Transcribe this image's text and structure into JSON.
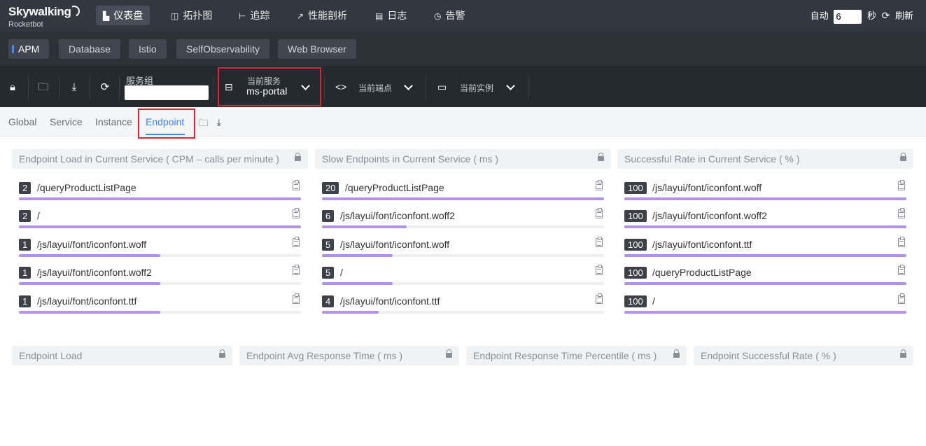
{
  "brand": {
    "name": "Skywalking",
    "subtitle": "Rocketbot"
  },
  "topnav": {
    "items": [
      {
        "label": "仪表盘",
        "icon": "dashboard-icon",
        "active": true
      },
      {
        "label": "拓扑图",
        "icon": "topology-icon",
        "active": false
      },
      {
        "label": "追踪",
        "icon": "trace-icon",
        "active": false
      },
      {
        "label": "性能剖析",
        "icon": "profile-icon",
        "active": false
      },
      {
        "label": "日志",
        "icon": "log-icon",
        "active": false
      },
      {
        "label": "告警",
        "icon": "alarm-icon",
        "active": false
      }
    ],
    "auto_label": "自动",
    "auto_value": "6",
    "seconds_label": "秒",
    "refresh_label": "刷新"
  },
  "layers": {
    "items": [
      {
        "label": "APM",
        "active": true
      },
      {
        "label": "Database",
        "active": false
      },
      {
        "label": "Istio",
        "active": false
      },
      {
        "label": "SelfObservability",
        "active": false
      },
      {
        "label": "Web Browser",
        "active": false
      }
    ]
  },
  "toolbar": {
    "service_group_label": "服务组",
    "service_group_value": "",
    "current_service_label": "当前服务",
    "current_service_value": "ms-portal",
    "current_endpoint_label": "当前端点",
    "current_instance_label": "当前实例"
  },
  "dashboard_tabs": {
    "items": [
      {
        "label": "Global",
        "active": false
      },
      {
        "label": "Service",
        "active": false
      },
      {
        "label": "Instance",
        "active": false
      },
      {
        "label": "Endpoint",
        "active": true
      }
    ]
  },
  "panels": [
    {
      "title": "Endpoint Load in Current Service ( CPM – calls per minute )",
      "rows": [
        {
          "value": "2",
          "name": "/queryProductListPage",
          "fill": 1.0
        },
        {
          "value": "2",
          "name": "/",
          "fill": 1.0
        },
        {
          "value": "1",
          "name": "/js/layui/font/iconfont.woff",
          "fill": 0.5
        },
        {
          "value": "1",
          "name": "/js/layui/font/iconfont.woff2",
          "fill": 0.5
        },
        {
          "value": "1",
          "name": "/js/layui/font/iconfont.ttf",
          "fill": 0.5
        }
      ]
    },
    {
      "title": "Slow Endpoints in Current Service ( ms )",
      "rows": [
        {
          "value": "20",
          "name": "/queryProductListPage",
          "fill": 1.0
        },
        {
          "value": "6",
          "name": "/js/layui/font/iconfont.woff2",
          "fill": 0.3
        },
        {
          "value": "5",
          "name": "/js/layui/font/iconfont.woff",
          "fill": 0.25
        },
        {
          "value": "5",
          "name": "/",
          "fill": 0.25
        },
        {
          "value": "4",
          "name": "/js/layui/font/iconfont.ttf",
          "fill": 0.2
        }
      ]
    },
    {
      "title": "Successful Rate in Current Service ( % )",
      "rows": [
        {
          "value": "100",
          "name": "/js/layui/font/iconfont.woff",
          "fill": 1.0
        },
        {
          "value": "100",
          "name": "/js/layui/font/iconfont.woff2",
          "fill": 1.0
        },
        {
          "value": "100",
          "name": "/js/layui/font/iconfont.ttf",
          "fill": 1.0
        },
        {
          "value": "100",
          "name": "/queryProductListPage",
          "fill": 1.0
        },
        {
          "value": "100",
          "name": "/",
          "fill": 1.0
        }
      ]
    }
  ],
  "bottom_panels": [
    {
      "title": "Endpoint Load"
    },
    {
      "title": "Endpoint Avg Response Time ( ms )"
    },
    {
      "title": "Endpoint Response Time Percentile ( ms )"
    },
    {
      "title": "Endpoint Successful Rate ( % )"
    }
  ],
  "colors": {
    "highlight": "#e0232b",
    "accent": "#3d86f5",
    "bar": "#b292e8",
    "nav_bg": "#333840"
  }
}
